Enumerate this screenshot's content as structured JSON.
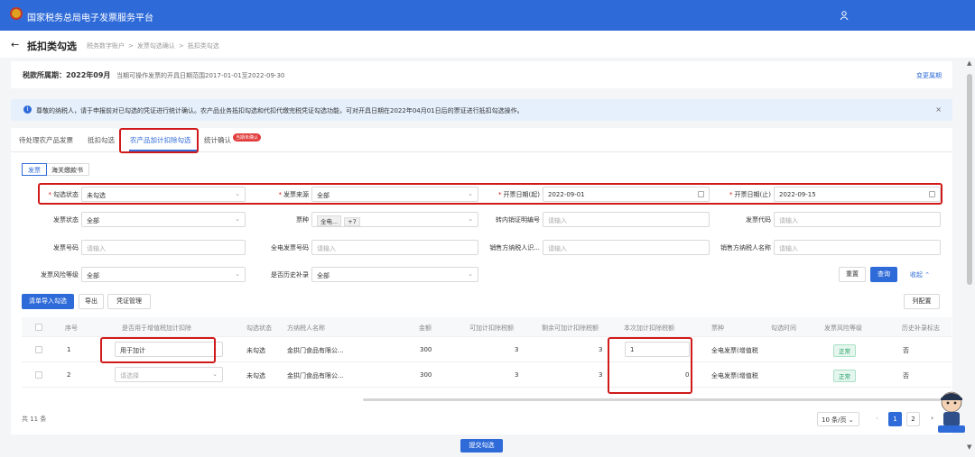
{
  "header": {
    "app_title": "国家税务总局电子发票服务平台"
  },
  "nav": {
    "page_title": "抵扣类勾选",
    "breadcrumbs": [
      "税务数字账户",
      "发票勾选确认",
      "抵扣类勾选"
    ]
  },
  "period": {
    "label": "税款所属期：2022年09月",
    "description": "当期可操作发票的开具日期范围2017-01-01至2022-09-30",
    "change_link": "变更属期"
  },
  "notice": {
    "text": "尊敬的纳税人，请于申报前对已勾选的凭证进行统计确认。农产品业务抵扣勾选和代扣代缴完税凭证勾选功能，可对开具日期在2022年04月01日后的票证进行抵扣勾选操作。"
  },
  "tabs": [
    {
      "label": "待处理农产品发票"
    },
    {
      "label": "抵扣勾选"
    },
    {
      "label": "农产品加计扣除勾选"
    },
    {
      "label": "统计确认"
    }
  ],
  "tab_badge": "当期未确认",
  "subtabs": [
    "发票",
    "海关缴款书"
  ],
  "filters": {
    "status_label": "勾选状态",
    "status_value": "未勾选",
    "source_label": "发票来源",
    "source_value": "全部",
    "date_start_label": "开票日期(起)",
    "date_start_value": "2022-09-01",
    "date_end_label": "开票日期(止)",
    "date_end_value": "2022-09-15",
    "invoice_status_label": "发票状态",
    "invoice_status_value": "全部",
    "type_label": "票种",
    "type_value": "全电...",
    "type_more": "+7",
    "transfer_label": "转内销证明编号",
    "transfer_placeholder": "请输入",
    "code_label": "发票代码",
    "code_placeholder": "请输入",
    "number_label": "发票号码",
    "number_placeholder": "请输入",
    "full_number_label": "全电发票号码",
    "full_number_placeholder": "请输入",
    "seller_id_label": "销售方纳税人识...",
    "seller_id_placeholder": "请输入",
    "seller_name_label": "销售方纳税人名称",
    "seller_name_placeholder": "请输入",
    "risk_label": "发票风险等级",
    "risk_value": "全部",
    "history_label": "是否历史补录",
    "history_value": "全部",
    "reset": "重置",
    "query": "查询",
    "collapse": "收起"
  },
  "toolbar": {
    "import": "清单导入勾选",
    "export": "导出",
    "voucher": "凭证管理",
    "columns": "列配置"
  },
  "table": {
    "headers": [
      "序号",
      "是否用于增值税加计扣除",
      "勾选状态",
      "方纳税人名称",
      "金额",
      "可加计扣除税额",
      "剩余可加计扣除税额",
      "本次加计扣除税额",
      "票种",
      "勾选时间",
      "发票风险等级",
      "历史补录标志"
    ],
    "rows": [
      {
        "idx": "1",
        "use": "用于加计",
        "status": "未勾选",
        "seller": "金拱门食品有限公...",
        "amount": "300",
        "deductible": "3",
        "remaining": "3",
        "current": "1",
        "type": "全电发票(增值税",
        "time": "",
        "risk": "正常",
        "history": "否"
      },
      {
        "idx": "2",
        "use": "请选择",
        "status": "未勾选",
        "seller": "金拱门食品有限公...",
        "amount": "300",
        "deductible": "3",
        "remaining": "3",
        "current": "0",
        "type": "全电发票(增值税",
        "time": "",
        "risk": "正常",
        "history": "否"
      }
    ]
  },
  "footer": {
    "total": "共 11 条",
    "page_size": "10 条/页",
    "pages": [
      "1",
      "2"
    ],
    "submit": "提交勾选"
  },
  "colors": {
    "brand": "#2f6bd8",
    "highlight": "#d01a1a"
  }
}
